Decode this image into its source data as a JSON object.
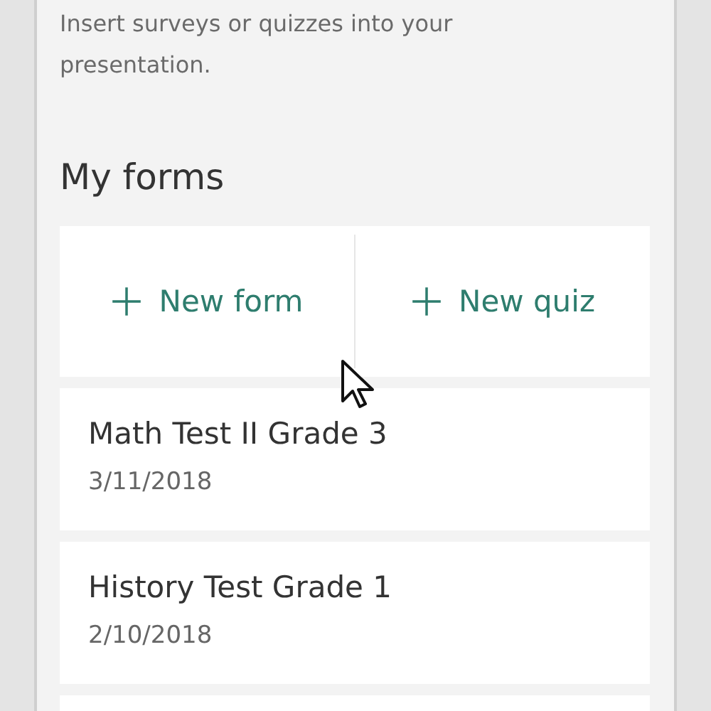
{
  "description": "Insert surveys or quizzes into your presentation.",
  "section_title": "My forms",
  "actions": [
    {
      "label": "New form"
    },
    {
      "label": "New quiz"
    }
  ],
  "forms": [
    {
      "title": "Math Test II Grade 3",
      "date": "3/11/2018"
    },
    {
      "title": "History Test Grade 1",
      "date": "2/10/2018"
    }
  ]
}
